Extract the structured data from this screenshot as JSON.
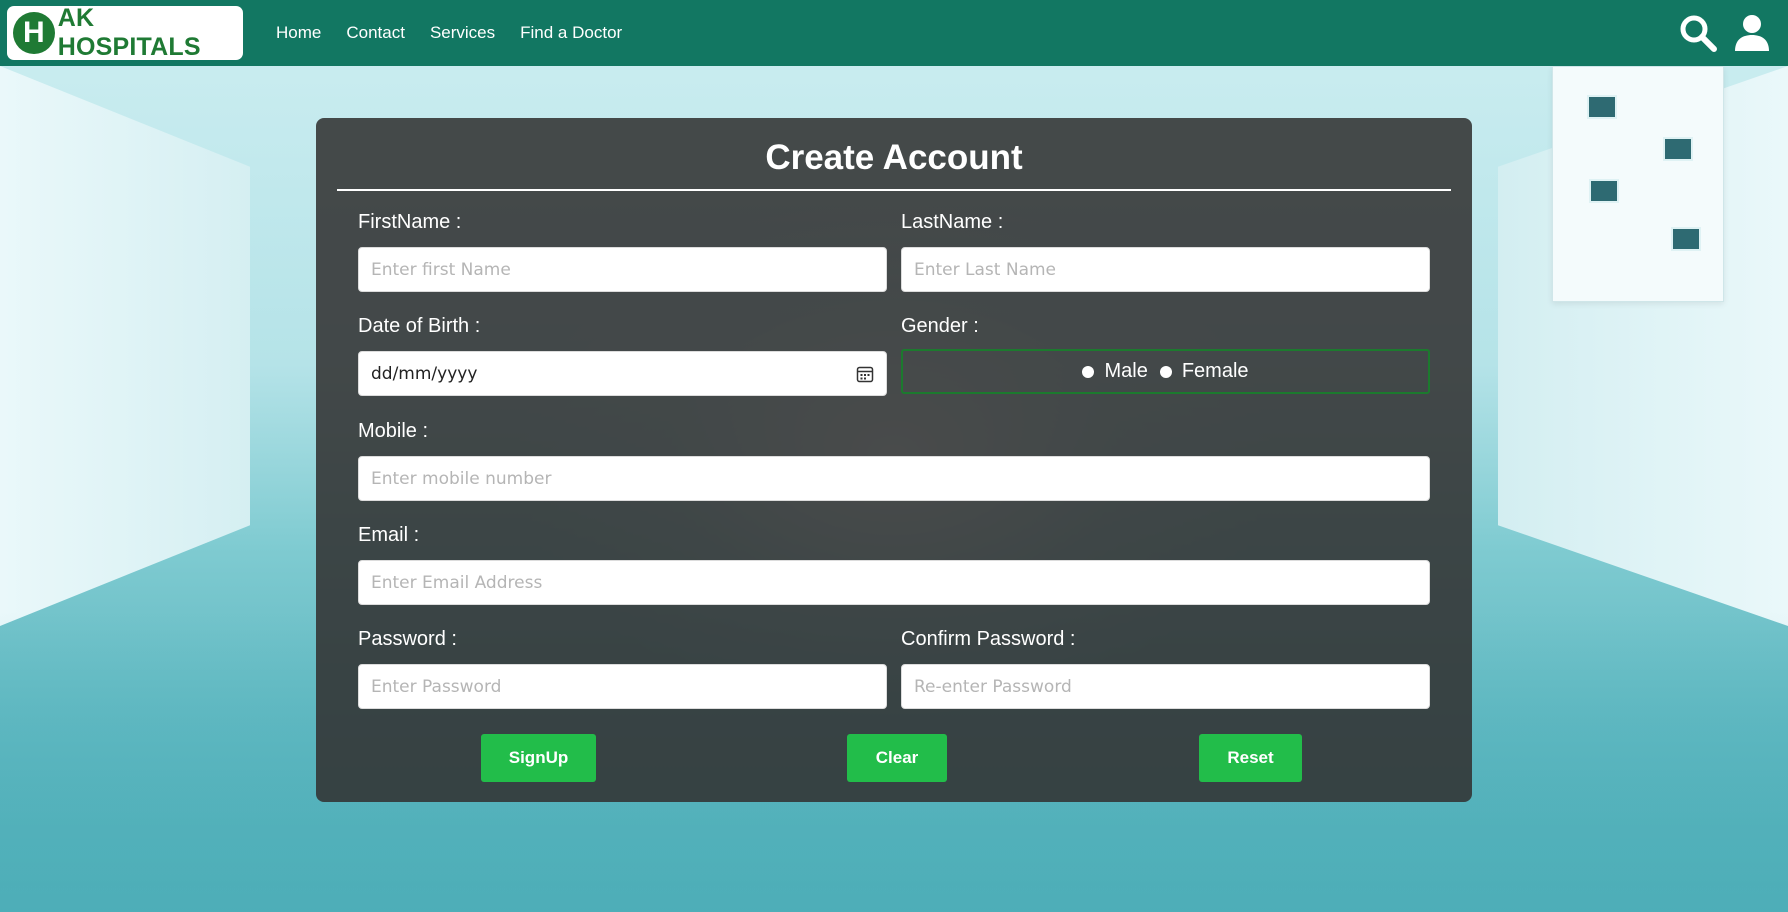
{
  "brand": {
    "badge_letter": "H",
    "name": "AK HOSPITALS"
  },
  "nav": {
    "links": [
      "Home",
      "Contact",
      "Services",
      "Find a Doctor"
    ],
    "icons": [
      "search-icon",
      "user-icon"
    ]
  },
  "form": {
    "title": "Create Account",
    "firstname": {
      "label": "FirstName :",
      "placeholder": "Enter first Name"
    },
    "lastname": {
      "label": "LastName :",
      "placeholder": "Enter Last Name"
    },
    "dob": {
      "label": "Date of Birth :",
      "value": "dd/mm/yyyy"
    },
    "gender": {
      "label": "Gender :",
      "options": [
        "Male",
        "Female"
      ]
    },
    "mobile": {
      "label": "Mobile :",
      "placeholder": "Enter mobile number"
    },
    "email": {
      "label": "Email :",
      "placeholder": "Enter Email Address"
    },
    "password": {
      "label": "Password :",
      "placeholder": "Enter Password"
    },
    "confirm_password": {
      "label": "Confirm Password :",
      "placeholder": "Re-enter Password"
    },
    "buttons": {
      "signup": "SignUp",
      "clear": "Clear",
      "reset": "Reset"
    }
  },
  "colors": {
    "navbar": "#127762",
    "brand_green": "#1f7a34",
    "button_green": "#22bd4a",
    "card_bg": "rgba(50,50,50,0.88)"
  }
}
